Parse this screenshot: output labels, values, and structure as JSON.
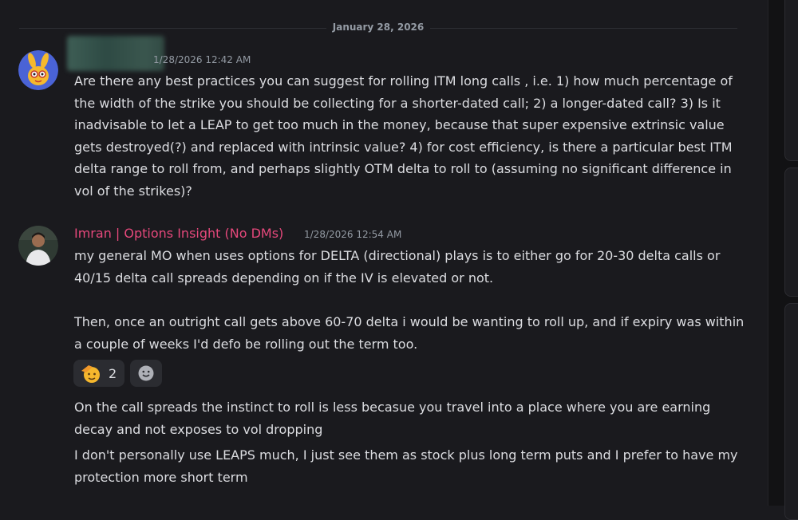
{
  "date_divider": "January 28, 2026",
  "messages": [
    {
      "timestamp": "1/28/2026 12:42 AM",
      "text": "Are there any best practices you can suggest for rolling ITM long calls , i.e. 1) how much percentage of the width of the strike you should be collecting for a shorter-dated call; 2) a longer-dated call? 3) Is it inadvisable to let a LEAP to get too much in the money, because that super expensive extrinsic value gets destroyed(?) and replaced with intrinsic value? 4) for cost efficiency, is there a particular best ITM delta range to roll from, and perhaps slightly OTM delta to roll to (assuming no significant difference in vol of the strikes)?"
    },
    {
      "author": "Imran | Options Insight (No DMs)",
      "timestamp": "1/28/2026 12:54 AM",
      "text_1": "my general MO when uses options for DELTA (directional) plays is to either go for 20-30 delta calls or 40/15 delta call spreads depending on if the IV is elevated or not.",
      "text_2": "Then, once an outright call gets above 60-70 delta i would be wanting to roll up, and if expiry was within a couple of weeks I'd defo be rolling out the term too.",
      "reactions": [
        {
          "emoji": "saluting-face",
          "count": "2"
        },
        {
          "emoji": "add-reaction"
        }
      ]
    },
    {
      "text": "On the call spreads the instinct to roll is less becasue you travel into a place where you are earning decay and not exposes to vol dropping"
    },
    {
      "text": "I don't personally use LEAPS much, I just see them as stock plus long term puts and I prefer to have my protection more short term"
    }
  ],
  "colors": {
    "background": "#1a1a1e",
    "text": "#dcdde1",
    "muted": "#949ba4",
    "author_name": "#e5487b",
    "reaction_bg": "#2b2c31"
  }
}
